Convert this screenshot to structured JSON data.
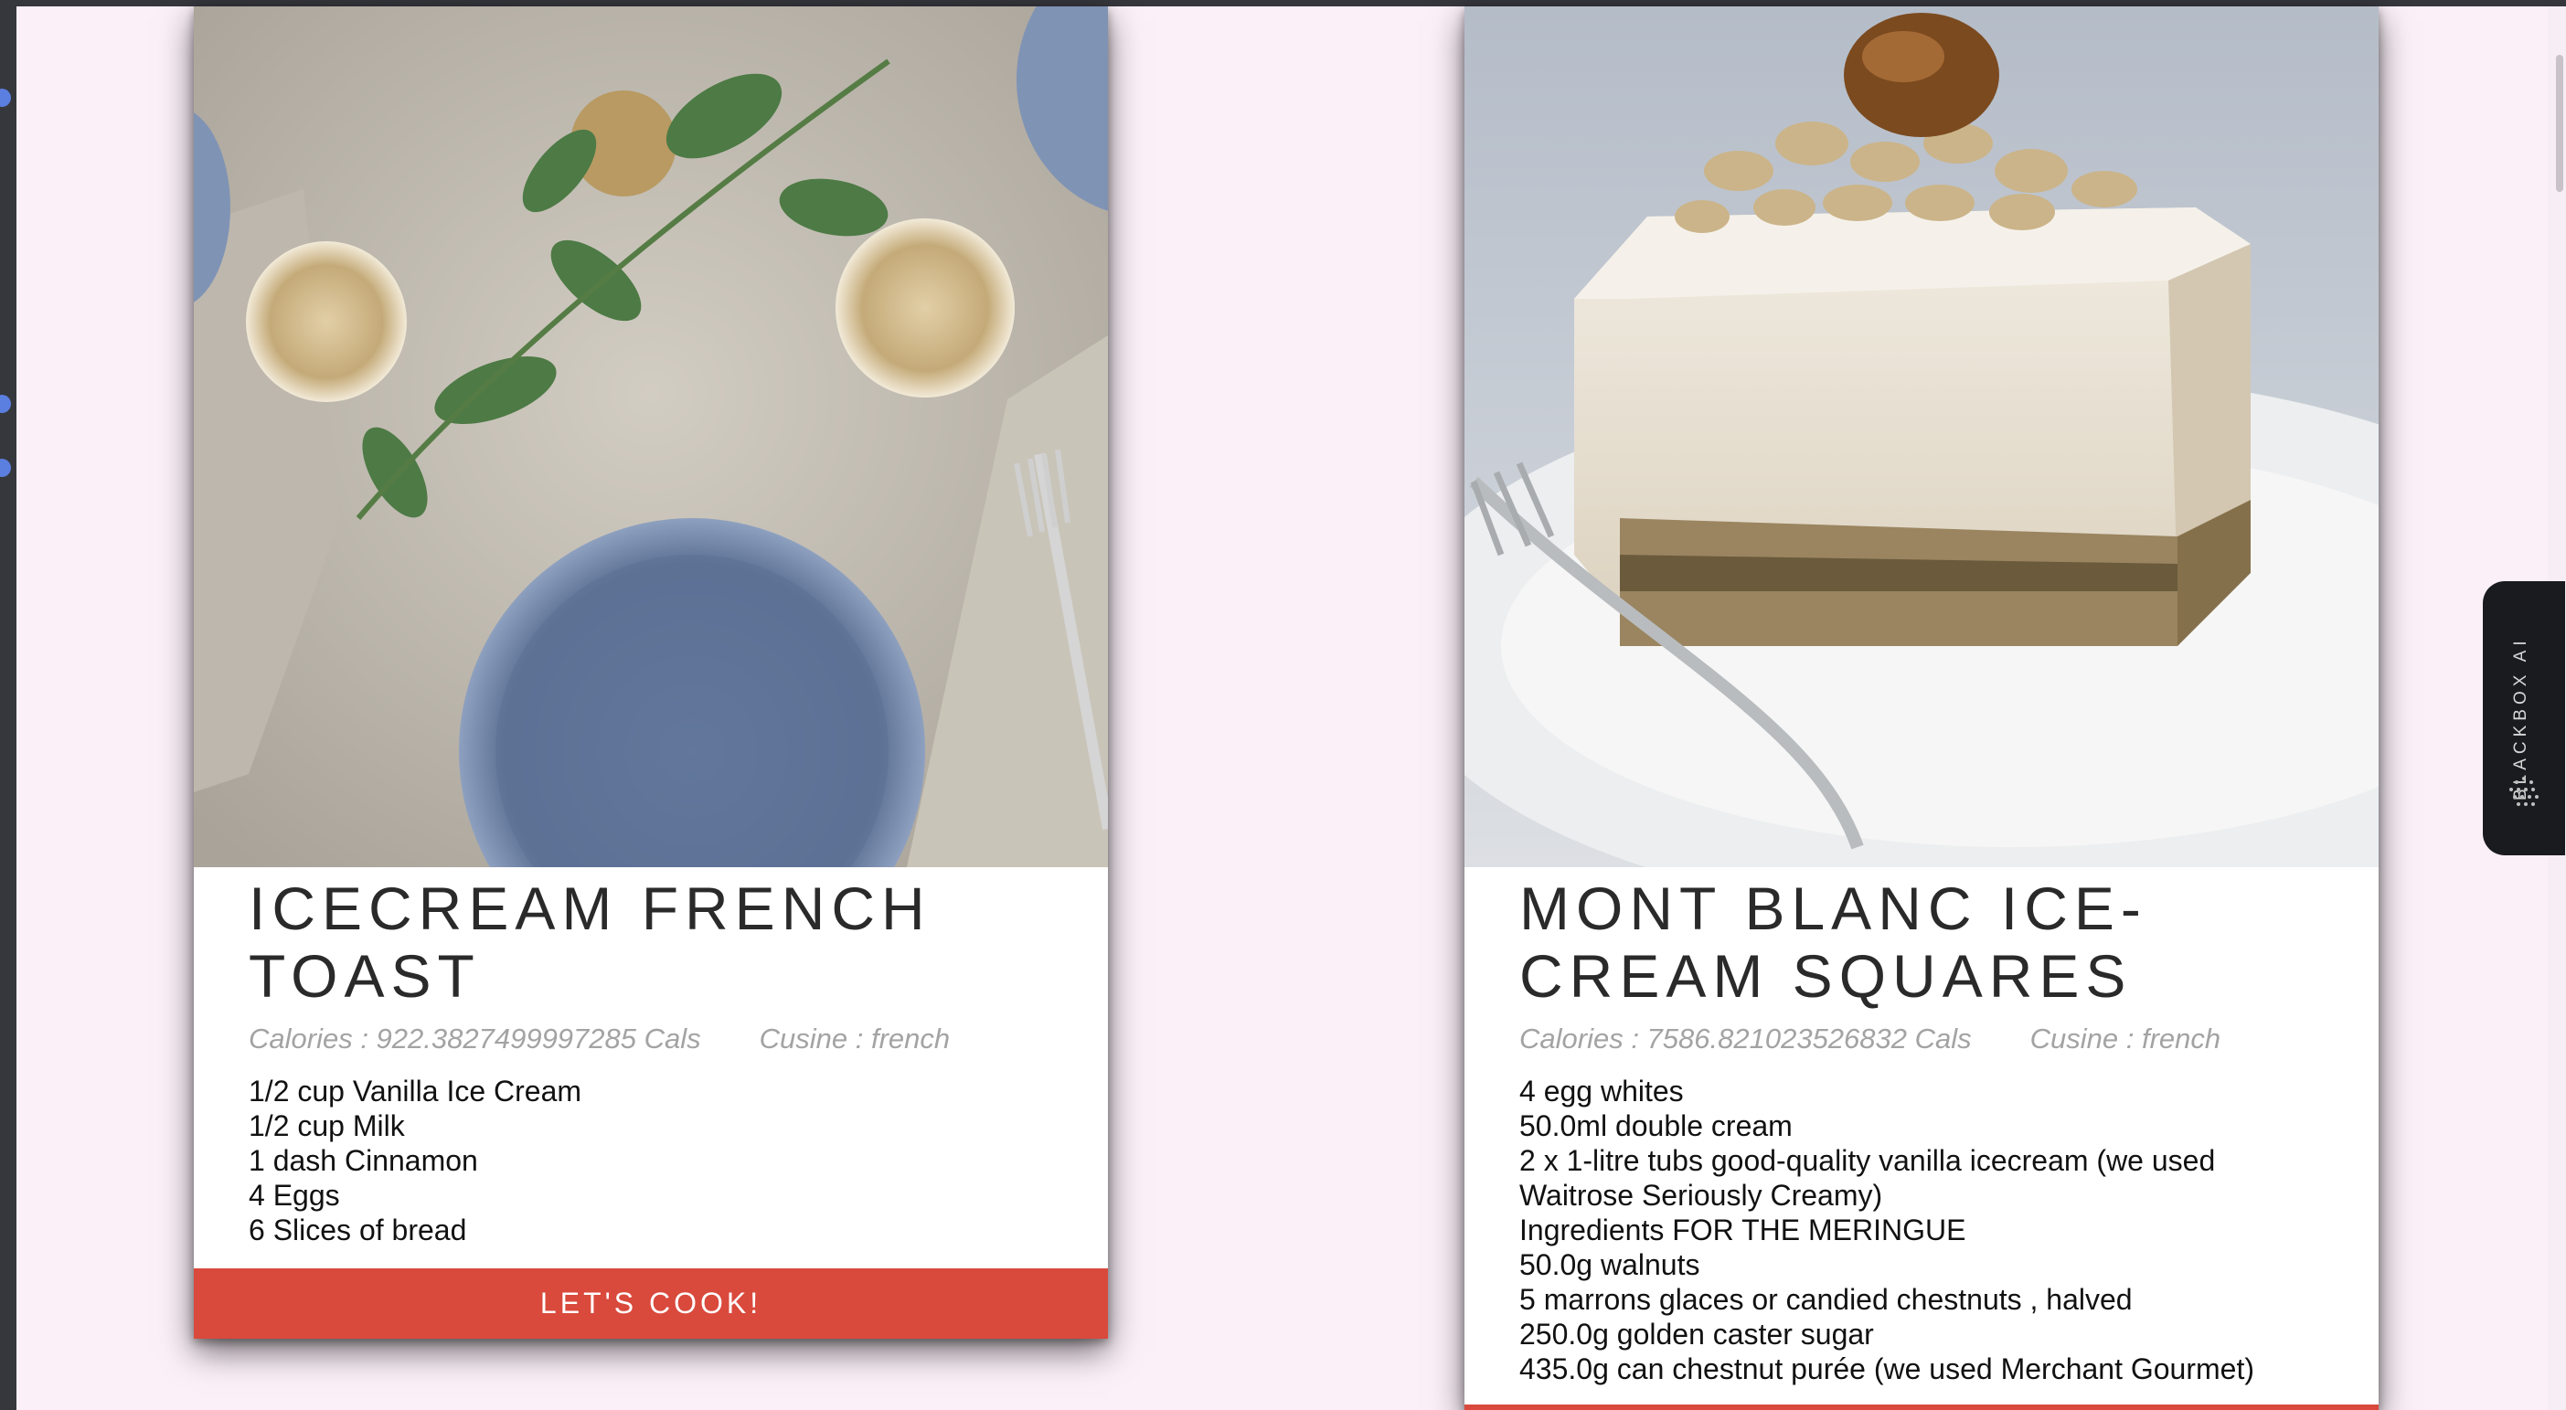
{
  "cards": [
    {
      "title": "ICECREAM FRENCH TOAST",
      "calories": "Calories : 922.3827499997285 Cals",
      "cuisine": "Cusine : french",
      "ingredients": [
        "1/2 cup Vanilla Ice Cream",
        "1/2 cup Milk",
        "1 dash Cinnamon",
        "4 Eggs",
        "6 Slices of bread"
      ],
      "button_label": "LET'S COOK!"
    },
    {
      "title": "MONT BLANC ICE-CREAM SQUARES",
      "calories": "Calories : 7586.821023526832 Cals",
      "cuisine": "Cusine : french",
      "ingredients": [
        "4 egg whites",
        "50.0ml double cream",
        "2 x 1-litre tubs good-quality vanilla icecream (we used",
        "Waitrose Seriously Creamy)",
        "Ingredients FOR THE MERINGUE",
        "50.0g walnuts",
        "5 marrons glaces or candied chestnuts , halved",
        "250.0g golden caster sugar",
        "435.0g can chestnut purée (we used Merchant Gourmet)"
      ]
    }
  ],
  "sidebar_widget": {
    "label": "BLACKBOX AI",
    "icon": "blackbox-logo-icon"
  },
  "colors": {
    "page_bg": "#fbf0f8",
    "button": "#d9493c",
    "title": "#2a2a2a",
    "meta": "#a3a3a3"
  }
}
